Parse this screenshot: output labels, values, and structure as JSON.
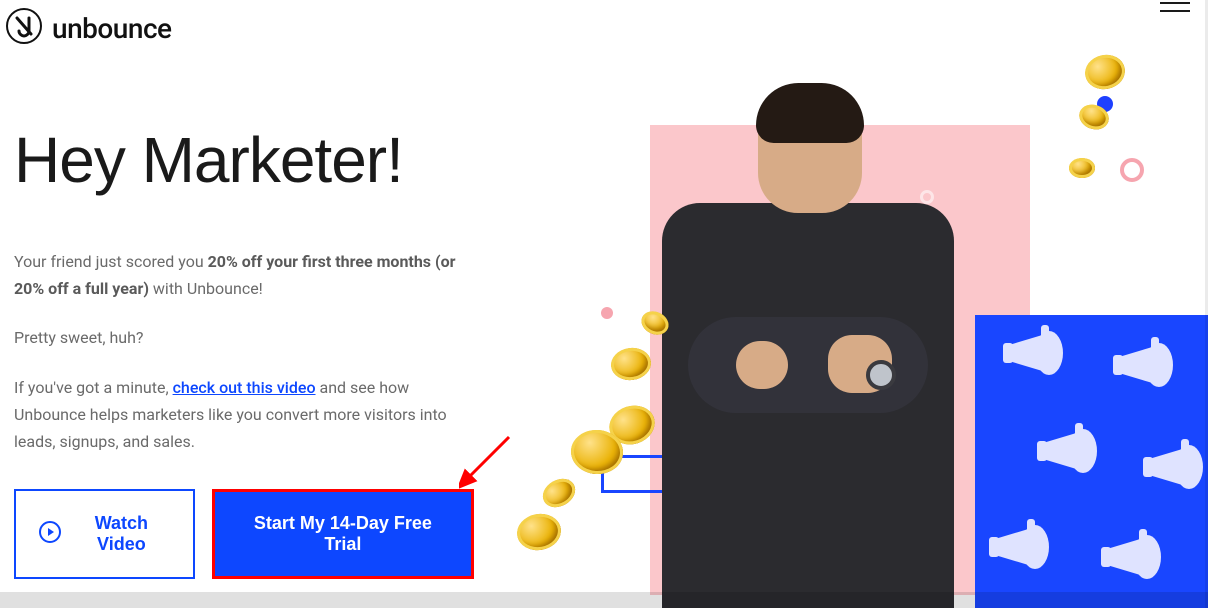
{
  "brand": {
    "name": "unbounce"
  },
  "headline": "Hey Marketer!",
  "body": {
    "p1_lead": "Your friend just scored you ",
    "p1_bold": "20% off your first three months (or 20% off a full year)",
    "p1_tail": " with Unbounce!",
    "p2": "Pretty sweet, huh?",
    "p3_lead": "If you've got a minute, ",
    "p3_link": "check out this video",
    "p3_tail": " and see how Unbounce helps marketers like you convert more visitors into leads, signups, and sales."
  },
  "cta": {
    "watch_label": "Watch Video",
    "primary_label": "Start My 14-Day Free Trial"
  },
  "colors": {
    "accent": "#0d47ff",
    "highlight_outline": "#ff0000",
    "pink": "#fbc7cb",
    "blue_block": "#1946ff",
    "coin": "#eab308"
  },
  "icons": {
    "logo": "unbounce-logo-icon",
    "play": "play-circle-icon",
    "menu": "hamburger-icon",
    "coin": "coin-icon",
    "megaphone": "megaphone-icon",
    "arrow": "red-arrow-icon"
  }
}
